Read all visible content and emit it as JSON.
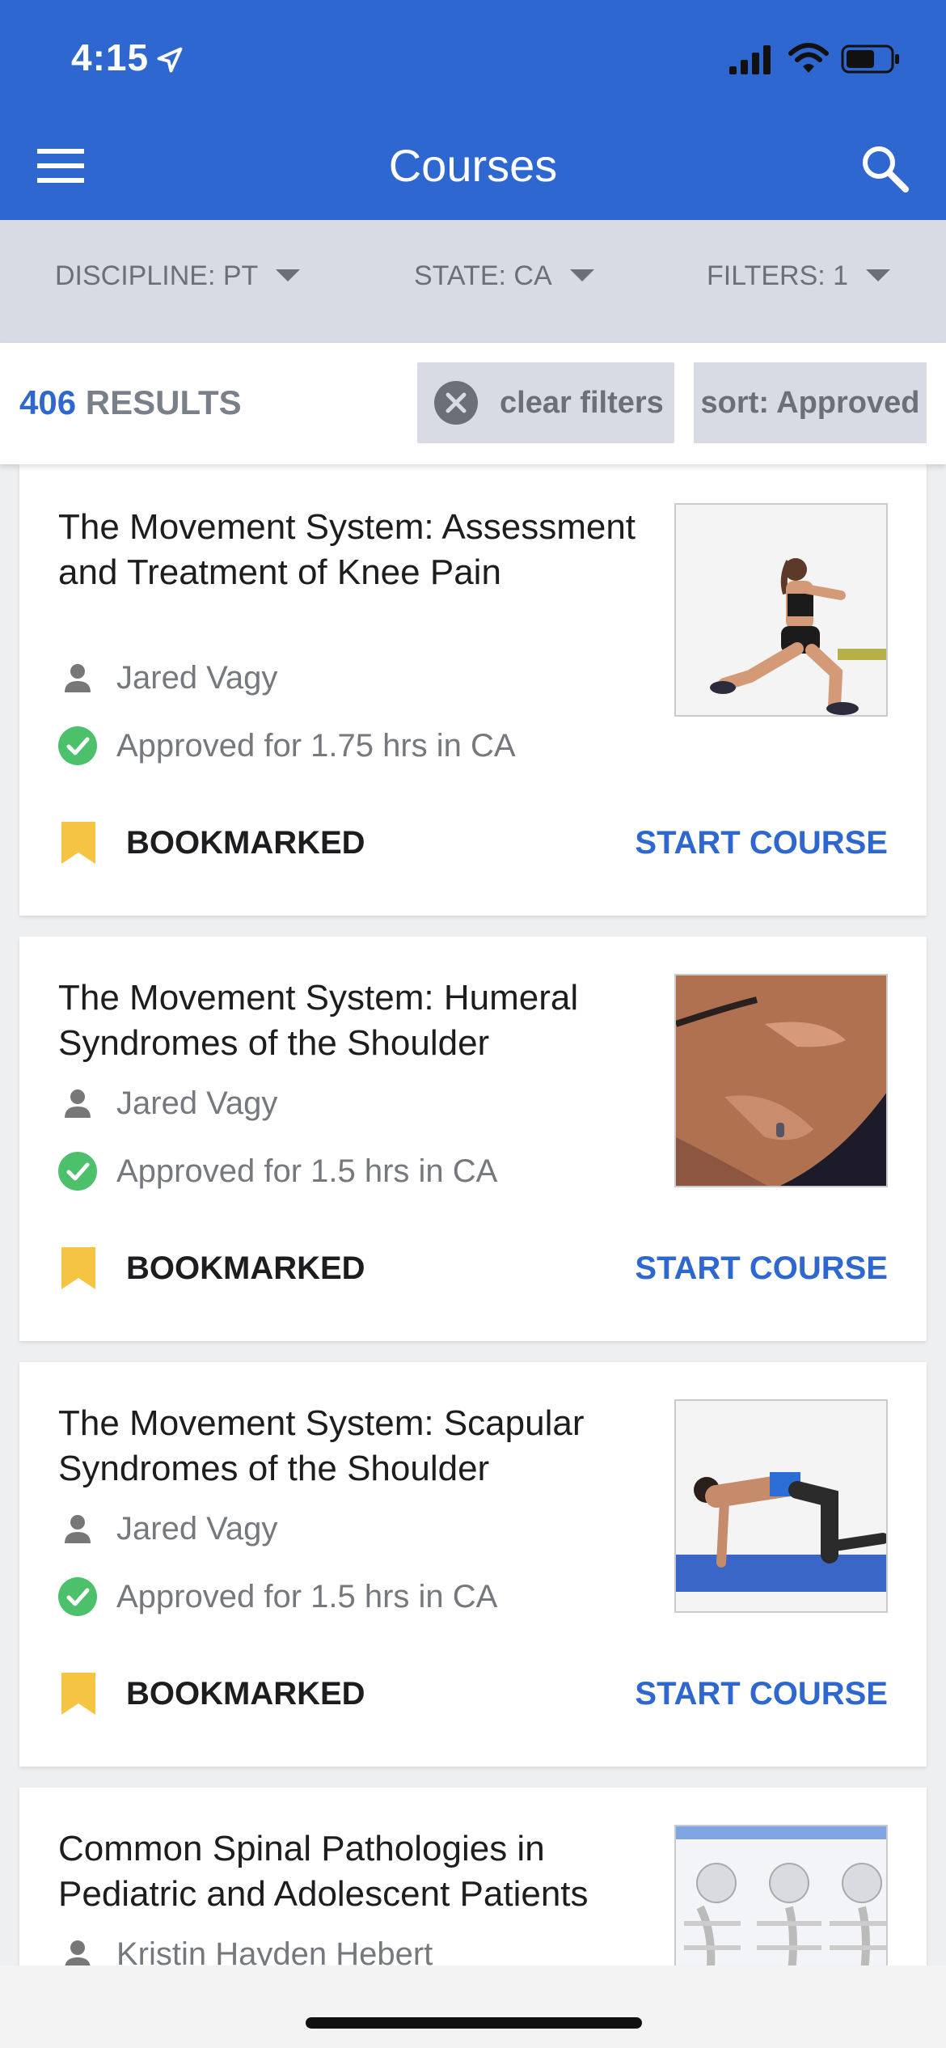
{
  "status_bar": {
    "time": "4:15"
  },
  "header": {
    "title": "Courses"
  },
  "filters": {
    "discipline": "DISCIPLINE: PT",
    "state": "STATE: CA",
    "filters": "FILTERS: 1"
  },
  "results": {
    "count": "406",
    "label": "RESULTS",
    "clear_label": "clear filters",
    "sort_label": "sort: Approved"
  },
  "courses": [
    {
      "title": "The Movement System: Assessment and Treatment of Knee Pain",
      "author": "Jared Vagy",
      "approval": "Approved for 1.75 hrs in CA",
      "bookmark_label": "BOOKMARKED",
      "action_label": "START COURSE"
    },
    {
      "title": "The Movement System: Humeral Syndromes of the Shoulder",
      "author": "Jared Vagy",
      "approval": "Approved for 1.5 hrs in CA",
      "bookmark_label": "BOOKMARKED",
      "action_label": "START COURSE"
    },
    {
      "title": "The Movement System: Scapular Syndromes of the Shoulder",
      "author": "Jared Vagy",
      "approval": "Approved for 1.5 hrs in CA",
      "bookmark_label": "BOOKMARKED",
      "action_label": "START COURSE"
    },
    {
      "title": "Common Spinal Pathologies in Pediatric and Adolescent Patients",
      "author": "Kristin Hayden Hebert"
    }
  ],
  "colors": {
    "primary": "#2e67cf",
    "bookmark": "#f6c443",
    "approved": "#4cc06a",
    "filter_bg": "#d8dbe3"
  },
  "icons": [
    "location-arrow-icon",
    "signal-icon",
    "wifi-icon",
    "battery-icon",
    "menu-icon",
    "search-icon",
    "clear-x-icon",
    "person-icon",
    "check-circle-icon",
    "bookmark-icon"
  ]
}
